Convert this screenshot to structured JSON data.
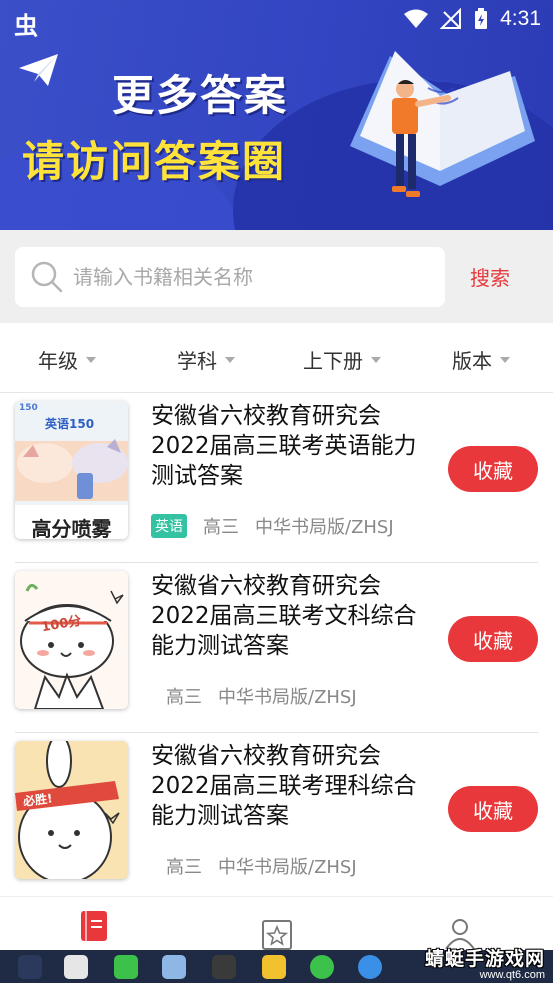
{
  "status_bar": {
    "app_glyph": "虫",
    "time": "4:31"
  },
  "banner": {
    "title_line1": "更多答案",
    "title_line2": "请访问答案圈"
  },
  "search": {
    "placeholder": "请输入书籍相关名称",
    "button_label": "搜索"
  },
  "filters": [
    {
      "label": "年级"
    },
    {
      "label": "学科"
    },
    {
      "label": "上下册"
    },
    {
      "label": "版本"
    }
  ],
  "items": [
    {
      "title": "安徽省六校教育研究会2022届高三联考英语能力测试答案",
      "thumb_text_top": "英语150",
      "thumb_text_bottom": "高分喷雾",
      "thumb_text_corner": "150",
      "subject_tag": "英语",
      "grade": "高三",
      "edition": "中华书局版/ZHSJ",
      "fav_label": "收藏"
    },
    {
      "title": "安徽省六校教育研究会2022届高三联考文科综合能力测试答案",
      "thumb_text_top": "100分",
      "grade": "高三",
      "edition": "中华书局版/ZHSJ",
      "fav_label": "收藏"
    },
    {
      "title": "安徽省六校教育研究会2022届高三联考理科综合能力测试答案",
      "thumb_text_top": "必胜!",
      "grade": "高三",
      "edition": "中华书局版/ZHSJ",
      "fav_label": "收藏"
    }
  ],
  "colors": {
    "banner": "#3345c2",
    "accent_red": "#e8383b",
    "tag_green": "#34c3a2",
    "title_yellow": "#ffe33b"
  },
  "watermark": {
    "name": "蜻蜓手游戏网",
    "url": "www.qt6.com"
  },
  "icons": [
    "paper-plane-icon",
    "search-icon",
    "notebook-icon",
    "star-icon",
    "user-icon"
  ]
}
